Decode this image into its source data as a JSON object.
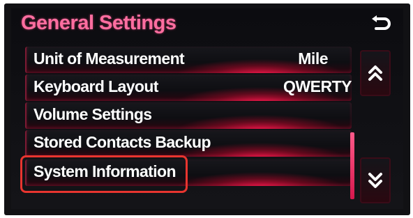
{
  "header": {
    "title": "General Settings",
    "back_icon": "back-arrow-icon"
  },
  "items": [
    {
      "label": "Unit of Measurement",
      "value": "Mile"
    },
    {
      "label": "Keyboard Layout",
      "value": "QWERTY"
    },
    {
      "label": "Volume Settings",
      "value": ""
    },
    {
      "label": "Stored Contacts Backup",
      "value": ""
    },
    {
      "label": "System Information",
      "value": ""
    }
  ],
  "scroll": {
    "up_icon": "double-chevron-up-icon",
    "down_icon": "double-chevron-down-icon"
  },
  "colors": {
    "accent": "#ff6ea0",
    "row_glow": "#eb1446",
    "highlight_box": "#e8352f",
    "text": "#ffffff"
  }
}
